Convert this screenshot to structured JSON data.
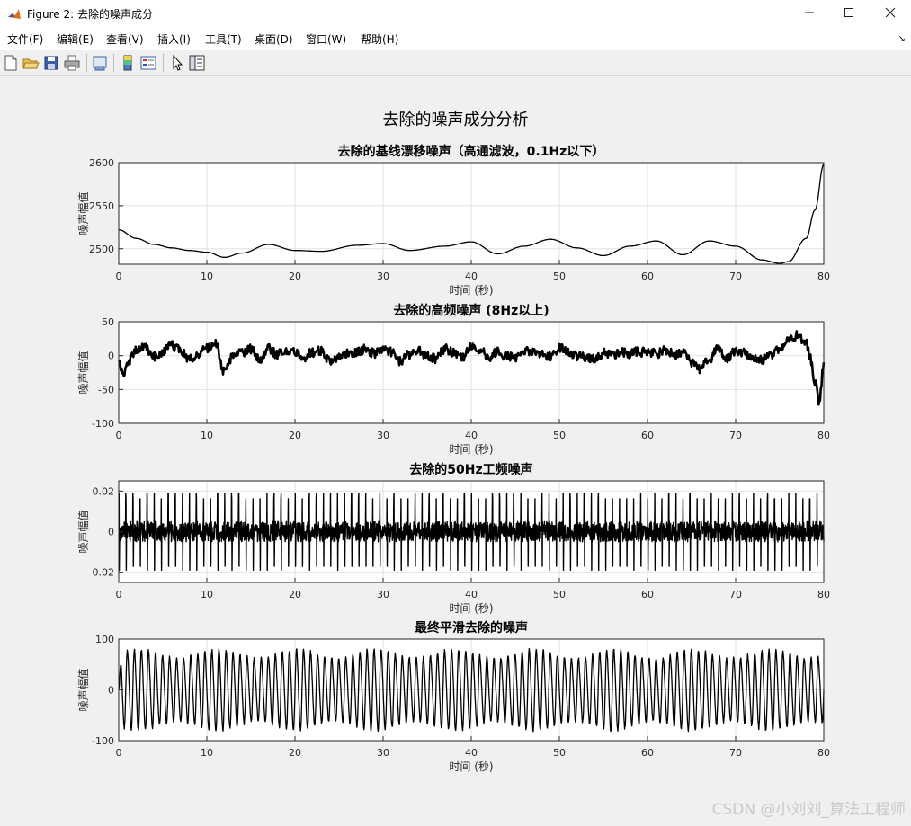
{
  "window": {
    "title": "Figure 2: 去除的噪声成分",
    "icon": "matlab-logo-icon",
    "controls": [
      "—",
      "☐",
      "✕"
    ]
  },
  "menu": [
    "文件(F)",
    "编辑(E)",
    "查看(V)",
    "插入(I)",
    "工具(T)",
    "桌面(D)",
    "窗口(W)",
    "帮助(H)"
  ],
  "toolbar": [
    "new-figure-icon",
    "open-file-icon",
    "save-icon",
    "print-icon",
    "print-preview-icon",
    "colorbar-icon",
    "legend-icon",
    "pointer-icon",
    "property-inspector-icon"
  ],
  "figure": {
    "suptitle": "去除的噪声成分分析",
    "watermark": "CSDN @小刘刘_算法工程师"
  },
  "chart_data": [
    {
      "type": "line",
      "title": "去除的基线漂移噪声（高通滤波，0.1Hz以下）",
      "xlabel": "时间 (秒)",
      "ylabel": "噪声幅值",
      "xlim": [
        0,
        80
      ],
      "ylim": [
        2482,
        2600
      ],
      "xticks": [
        0,
        10,
        20,
        30,
        40,
        50,
        60,
        70,
        80
      ],
      "yticks": [
        2500,
        2550,
        2600
      ],
      "grid": true,
      "line_color": "#000000",
      "x": [
        0,
        2,
        4,
        6,
        8,
        10,
        12,
        14,
        17,
        20,
        23,
        27,
        30,
        33,
        37,
        40,
        43,
        46,
        49,
        52,
        55,
        58,
        61,
        64,
        67,
        70,
        73,
        75,
        76,
        78,
        79,
        80
      ],
      "y": [
        2522,
        2512,
        2505,
        2501,
        2498,
        2496,
        2490,
        2495,
        2505,
        2498,
        2497,
        2504,
        2506,
        2498,
        2503,
        2508,
        2494,
        2503,
        2511,
        2501,
        2492,
        2503,
        2509,
        2493,
        2509,
        2503,
        2487,
        2483,
        2485,
        2512,
        2545,
        2598
      ]
    },
    {
      "type": "line",
      "title": "去除的高频噪声 (8Hz以上)",
      "xlabel": "时间 (秒)",
      "ylabel": "噪声幅值",
      "xlim": [
        0,
        80
      ],
      "ylim": [
        -100,
        50
      ],
      "xticks": [
        0,
        10,
        20,
        30,
        40,
        50,
        60,
        70,
        80
      ],
      "yticks": [
        -100,
        -50,
        0,
        50
      ],
      "grid": true,
      "line_color": "#000000",
      "x": [
        0,
        0.5,
        1,
        2,
        3,
        4,
        5,
        6,
        7,
        8,
        9,
        10,
        11,
        12,
        13,
        14,
        15,
        16,
        17,
        18,
        19,
        20,
        21,
        22,
        23,
        24,
        25,
        26,
        27,
        28,
        29,
        30,
        31,
        32,
        33,
        34,
        35,
        36,
        37,
        38,
        39,
        40,
        41,
        42,
        43,
        44,
        45,
        46,
        47,
        48,
        49,
        50,
        51,
        52,
        53,
        54,
        55,
        56,
        57,
        58,
        59,
        60,
        61,
        62,
        63,
        64,
        65,
        66,
        67,
        68,
        69,
        70,
        71,
        72,
        73,
        74,
        75,
        76,
        77,
        78,
        78.5,
        79,
        79.5,
        80
      ],
      "y": [
        -8,
        -28,
        -10,
        8,
        12,
        -2,
        5,
        15,
        8,
        -5,
        2,
        10,
        18,
        -25,
        0,
        5,
        10,
        -5,
        10,
        2,
        5,
        6,
        -2,
        5,
        8,
        -10,
        -2,
        4,
        5,
        10,
        3,
        8,
        5,
        -8,
        2,
        8,
        0,
        -4,
        10,
        5,
        -3,
        14,
        8,
        -2,
        5,
        0,
        -4,
        5,
        8,
        2,
        -2,
        12,
        5,
        0,
        -3,
        -6,
        4,
        0,
        5,
        3,
        6,
        4,
        3,
        7,
        2,
        4,
        -10,
        -20,
        -5,
        10,
        -5,
        8,
        4,
        -4,
        -6,
        0,
        10,
        22,
        30,
        18,
        -5,
        -40,
        -70,
        -10
      ]
    },
    {
      "type": "line",
      "title": "去除的50Hz工频噪声",
      "xlabel": "时间 (秒)",
      "ylabel": "噪声幅值",
      "xlim": [
        0,
        80
      ],
      "ylim": [
        -0.025,
        0.025
      ],
      "xticks": [
        0,
        10,
        20,
        30,
        40,
        50,
        60,
        70,
        80
      ],
      "yticks": [
        -0.02,
        0,
        0.02
      ],
      "ytick_labels": [
        "-0.02",
        "0",
        "0.02"
      ],
      "grid": true,
      "line_color": "#000000",
      "signal": {
        "description_units": "beats about every 0.8 s reaching about ±0.019 on top of a steady ±0.005 band",
        "beat_period": 0.8,
        "peak": 0.019,
        "band": 0.005
      }
    },
    {
      "type": "line",
      "title": "最终平滑去除的噪声",
      "xlabel": "时间 (秒)",
      "ylabel": "噪声幅值",
      "xlim": [
        0,
        80
      ],
      "ylim": [
        -100,
        100
      ],
      "xticks": [
        0,
        10,
        20,
        30,
        40,
        50,
        60,
        70,
        80
      ],
      "yticks": [
        -100,
        0,
        100
      ],
      "grid": true,
      "line_color": "#000000",
      "signal": {
        "period": 0.8,
        "amplitude": 75
      }
    }
  ]
}
